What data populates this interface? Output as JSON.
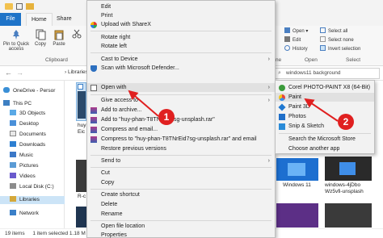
{
  "ribbon": {
    "tabs": {
      "file": "File",
      "home": "Home",
      "share": "Share"
    },
    "pin_label": "Pin to Quick access",
    "copy_label": "Copy",
    "paste_label": "Paste",
    "clipboard_group": "Clipboard",
    "open_label": "Open",
    "edit_label": "Edit",
    "history_label": "History",
    "select_all": "Select all",
    "select_none": "Select none",
    "invert_selection": "Invert selection",
    "open_group": "Open",
    "select_group": "Select",
    "partial_new_group": "ne"
  },
  "address": {
    "breadcrumb_partial": "Libraries",
    "search_text": "windows11 background"
  },
  "nav": {
    "onedrive": "OneDrive - Persor",
    "this_pc": "This PC",
    "objects3d": "3D Objects",
    "desktop": "Desktop",
    "documents": "Documents",
    "downloads": "Downloads",
    "music": "Music",
    "pictures": "Pictures",
    "videos": "Videos",
    "local_disk": "Local Disk (C:)",
    "libraries": "Libraries",
    "network": "Network"
  },
  "content": {
    "left_caption_1": "huy\nEic",
    "left_caption_2": "R-c",
    "windows11_caption": "Windows 11",
    "windows4j_caption": "windows-4jDbo\nWz5vfi-unsplash"
  },
  "status": {
    "items": "19 items",
    "selected": "1 item selected  1.18 M"
  },
  "context_menu": {
    "items": [
      {
        "label": "Edit"
      },
      {
        "label": "Print"
      },
      {
        "label": "Upload with ShareX"
      },
      {
        "label": "Rotate right"
      },
      {
        "label": "Rotate left"
      },
      {
        "label": "Cast to Device"
      },
      {
        "label": "Scan with Microsoft Defender..."
      },
      {
        "label": "Open with"
      },
      {
        "label": "Give access to"
      },
      {
        "label": "Add to archive..."
      },
      {
        "label": "Add to \"huy-phan-T8TNrEid7sg-unsplash.rar\""
      },
      {
        "label": "Compress and email..."
      },
      {
        "label": "Compress to \"huy-phan-T8TNrEid7sg-unsplash.rar\" and email"
      },
      {
        "label": "Restore previous versions"
      },
      {
        "label": "Send to"
      },
      {
        "label": "Cut"
      },
      {
        "label": "Copy"
      },
      {
        "label": "Create shortcut"
      },
      {
        "label": "Delete"
      },
      {
        "label": "Rename"
      },
      {
        "label": "Open file location"
      },
      {
        "label": "Properties"
      }
    ]
  },
  "open_with_submenu": {
    "items": [
      {
        "label": "Corel PHOTO-PAINT X8 (64-Bit)"
      },
      {
        "label": "Paint"
      },
      {
        "label": "Paint 3D"
      },
      {
        "label": "Photos"
      },
      {
        "label": "Snip & Sketch"
      },
      {
        "label": "Search the Microsoft Store"
      },
      {
        "label": "Choose another app"
      }
    ]
  },
  "annotations": {
    "badge1": "1",
    "badge2": "2",
    "color": "#e02020"
  },
  "colors": {
    "file_tab": "#1e73c8",
    "selection": "#cce4f7",
    "menu_bg": "#f2f2f2",
    "highlight": "#e1e1e1"
  }
}
